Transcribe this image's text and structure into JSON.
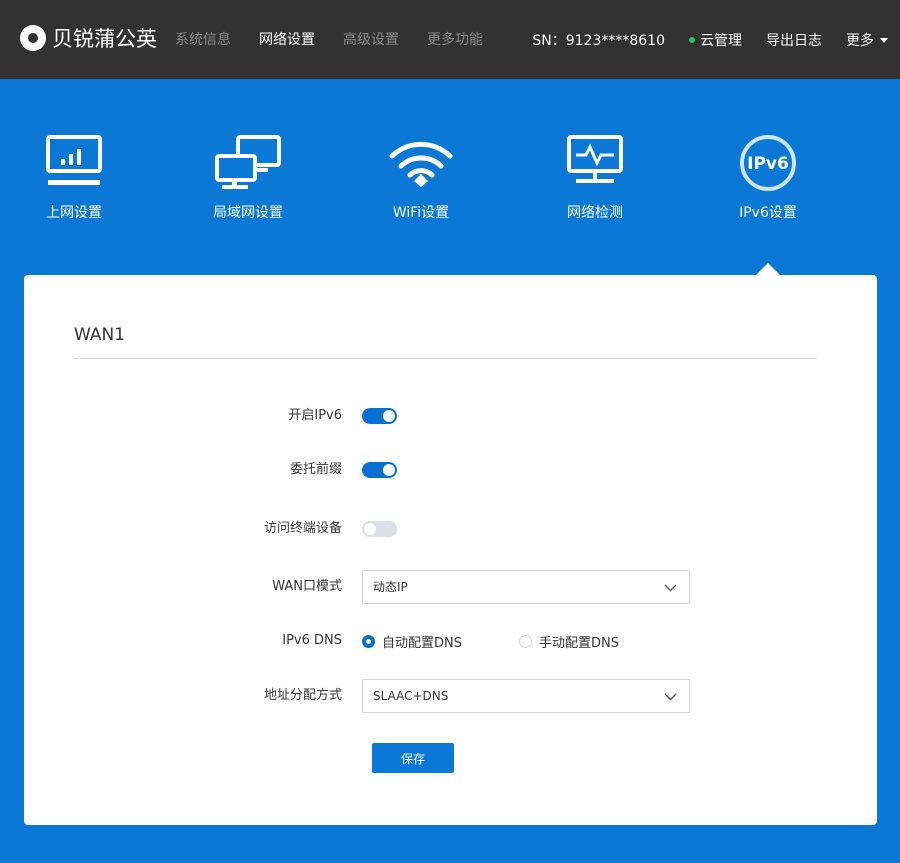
{
  "brand": {
    "name": "贝锐蒲公英"
  },
  "top_nav": [
    {
      "label": "系统信息",
      "active": false
    },
    {
      "label": "网络设置",
      "active": true
    },
    {
      "label": "高级设置",
      "active": false
    },
    {
      "label": "更多功能",
      "active": false
    }
  ],
  "header_right": {
    "sn": "SN：9123****8610",
    "cloud": "云管理",
    "export_log": "导出日志",
    "more": "更多"
  },
  "tabs": [
    {
      "label": "上网设置",
      "icon": "monitor-chart-icon"
    },
    {
      "label": "局域网设置",
      "icon": "lan-icon"
    },
    {
      "label": "WiFi设置",
      "icon": "wifi-icon"
    },
    {
      "label": "网络检测",
      "icon": "network-monitor-icon"
    },
    {
      "label": "IPv6设置",
      "icon": "ipv6-icon",
      "badge": "IPv6",
      "active": true
    }
  ],
  "card": {
    "title": "WAN1",
    "fields": {
      "enable_ipv6": {
        "label": "开启IPv6",
        "on": true
      },
      "delegate_prefix": {
        "label": "委托前缀",
        "on": true
      },
      "access_terminal": {
        "label": "访问终端设备",
        "on": false
      },
      "wan_mode": {
        "label": "WAN口模式",
        "value": "动态IP"
      },
      "ipv6_dns": {
        "label": "IPv6 DNS",
        "options": [
          "自动配置DNS",
          "手动配置DNS"
        ],
        "selected": "自动配置DNS"
      },
      "addr_alloc": {
        "label": "地址分配方式",
        "value": "SLAAC+DNS"
      }
    },
    "save_label": "保存"
  },
  "colors": {
    "accent": "#0a78d4",
    "topbar": "#323232",
    "toggle_on": "#0a6fd0",
    "toggle_off": "#dcdfe6",
    "online": "#22c55e"
  }
}
